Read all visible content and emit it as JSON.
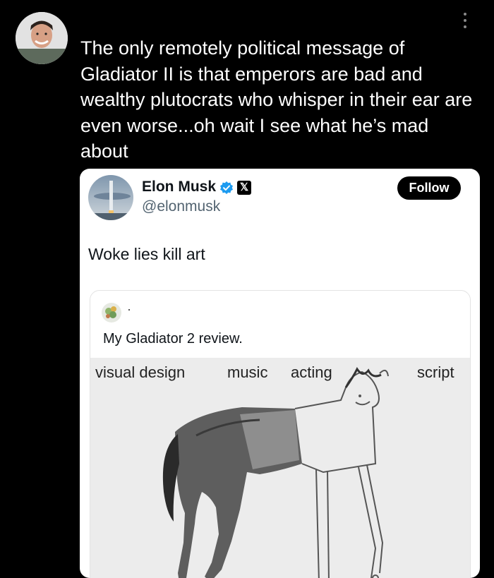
{
  "post": {
    "text": "The only remotely political message of Gladiator II is that emperors are bad and wealthy plutocrats who whisper in their ear are even worse...oh wait I see what he’s mad about"
  },
  "embedded_tweet": {
    "display_name": "Elon Musk",
    "handle": "@elonmusk",
    "follow_label": "Follow",
    "x_logo": "𝕏",
    "text": "Woke lies kill art",
    "quoted": {
      "name_dot": "·",
      "text": "My Gladiator 2 review.",
      "meme_labels": {
        "visual_design": "visual design",
        "music": "music",
        "acting": "acting",
        "script": "script"
      }
    }
  },
  "icons": {
    "more": "vertical-ellipsis-icon",
    "verified": "verified-badge-icon",
    "x": "x-logo-icon"
  },
  "colors": {
    "background": "#000000",
    "card": "#ffffff",
    "verified_blue": "#1d9bf0",
    "follow_bg": "#000000"
  }
}
